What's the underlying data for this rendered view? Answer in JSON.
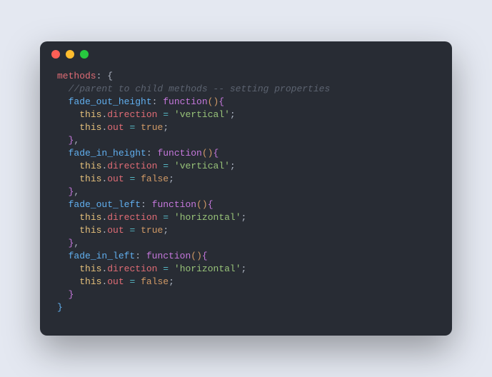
{
  "titlebar": {
    "dots": [
      "red",
      "yellow",
      "green"
    ]
  },
  "code": {
    "lines": [
      [
        [
          "methods",
          "prop"
        ],
        [
          ": {",
          "punc"
        ]
      ],
      [
        [
          "  //parent to child methods -- setting properties",
          "comm"
        ]
      ],
      [
        [
          "  ",
          "def"
        ],
        [
          "fade_out_height",
          "key"
        ],
        [
          ": ",
          "punc"
        ],
        [
          "function",
          "kw"
        ],
        [
          "(",
          "par"
        ],
        [
          ")",
          "par"
        ],
        [
          "{",
          "br1"
        ]
      ],
      [
        [
          "    ",
          "def"
        ],
        [
          "this",
          "this"
        ],
        [
          ".",
          "punc"
        ],
        [
          "direction",
          "field"
        ],
        [
          " ",
          "def"
        ],
        [
          "=",
          "op"
        ],
        [
          " ",
          "def"
        ],
        [
          "'vertical'",
          "str"
        ],
        [
          ";",
          "punc"
        ]
      ],
      [
        [
          "    ",
          "def"
        ],
        [
          "this",
          "this"
        ],
        [
          ".",
          "punc"
        ],
        [
          "out",
          "field"
        ],
        [
          " ",
          "def"
        ],
        [
          "=",
          "op"
        ],
        [
          " ",
          "def"
        ],
        [
          "true",
          "bool"
        ],
        [
          ";",
          "punc"
        ]
      ],
      [
        [
          "  ",
          "def"
        ],
        [
          "}",
          "br1"
        ],
        [
          ",",
          "punc"
        ]
      ],
      [
        [
          "  ",
          "def"
        ],
        [
          "fade_in_height",
          "key"
        ],
        [
          ": ",
          "punc"
        ],
        [
          "function",
          "kw"
        ],
        [
          "(",
          "par"
        ],
        [
          ")",
          "par"
        ],
        [
          "{",
          "br1"
        ]
      ],
      [
        [
          "    ",
          "def"
        ],
        [
          "this",
          "this"
        ],
        [
          ".",
          "punc"
        ],
        [
          "direction",
          "field"
        ],
        [
          " ",
          "def"
        ],
        [
          "=",
          "op"
        ],
        [
          " ",
          "def"
        ],
        [
          "'vertical'",
          "str"
        ],
        [
          ";",
          "punc"
        ]
      ],
      [
        [
          "    ",
          "def"
        ],
        [
          "this",
          "this"
        ],
        [
          ".",
          "punc"
        ],
        [
          "out",
          "field"
        ],
        [
          " ",
          "def"
        ],
        [
          "=",
          "op"
        ],
        [
          " ",
          "def"
        ],
        [
          "false",
          "bool"
        ],
        [
          ";",
          "punc"
        ]
      ],
      [
        [
          "  ",
          "def"
        ],
        [
          "}",
          "br1"
        ],
        [
          ",",
          "punc"
        ]
      ],
      [
        [
          "  ",
          "def"
        ],
        [
          "fade_out_left",
          "key"
        ],
        [
          ": ",
          "punc"
        ],
        [
          "function",
          "kw"
        ],
        [
          "(",
          "par"
        ],
        [
          ")",
          "par"
        ],
        [
          "{",
          "br1"
        ]
      ],
      [
        [
          "    ",
          "def"
        ],
        [
          "this",
          "this"
        ],
        [
          ".",
          "punc"
        ],
        [
          "direction",
          "field"
        ],
        [
          " ",
          "def"
        ],
        [
          "=",
          "op"
        ],
        [
          " ",
          "def"
        ],
        [
          "'horizontal'",
          "str"
        ],
        [
          ";",
          "punc"
        ]
      ],
      [
        [
          "    ",
          "def"
        ],
        [
          "this",
          "this"
        ],
        [
          ".",
          "punc"
        ],
        [
          "out",
          "field"
        ],
        [
          " ",
          "def"
        ],
        [
          "=",
          "op"
        ],
        [
          " ",
          "def"
        ],
        [
          "true",
          "bool"
        ],
        [
          ";",
          "punc"
        ]
      ],
      [
        [
          "  ",
          "def"
        ],
        [
          "}",
          "br1"
        ],
        [
          ",",
          "punc"
        ]
      ],
      [
        [
          "  ",
          "def"
        ],
        [
          "fade_in_left",
          "key"
        ],
        [
          ": ",
          "punc"
        ],
        [
          "function",
          "kw"
        ],
        [
          "(",
          "par"
        ],
        [
          ")",
          "par"
        ],
        [
          "{",
          "br1"
        ]
      ],
      [
        [
          "    ",
          "def"
        ],
        [
          "this",
          "this"
        ],
        [
          ".",
          "punc"
        ],
        [
          "direction",
          "field"
        ],
        [
          " ",
          "def"
        ],
        [
          "=",
          "op"
        ],
        [
          " ",
          "def"
        ],
        [
          "'horizontal'",
          "str"
        ],
        [
          ";",
          "punc"
        ]
      ],
      [
        [
          "    ",
          "def"
        ],
        [
          "this",
          "this"
        ],
        [
          ".",
          "punc"
        ],
        [
          "out",
          "field"
        ],
        [
          " ",
          "def"
        ],
        [
          "=",
          "op"
        ],
        [
          " ",
          "def"
        ],
        [
          "false",
          "bool"
        ],
        [
          ";",
          "punc"
        ]
      ],
      [
        [
          "  ",
          "def"
        ],
        [
          "}",
          "br1"
        ]
      ],
      [
        [
          "}",
          "br2"
        ]
      ]
    ]
  }
}
